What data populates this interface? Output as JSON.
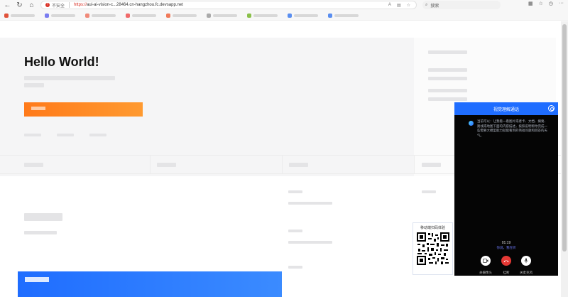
{
  "browser": {
    "insecure_label": "不安全",
    "url_proto": "https://",
    "url_rest": "aui-ai-vision-c...",
    "url_tail": "28464.cn-hangzhou.fc.devsapp.net",
    "search_placeholder": "搜索",
    "back_icon": "←",
    "refresh_icon": "↻",
    "home_icon": "⌂",
    "star_icon": "☆",
    "ellipsis": "···"
  },
  "colors": {
    "accent_blue": "#1f6dff",
    "cta_orange": "#ff7a1a",
    "hangup_red": "#e53935"
  },
  "hero": {
    "title": "Hello World!"
  },
  "qr": {
    "title": "移动端扫码体验"
  },
  "call_panel": {
    "title": "视觉理解通话",
    "message": "当前可以：让我看一看图片或者卡、文档、摘要、路线或地图下面的内容描述，按照说明帮你完成一些需要大模型能力就能看到的简短问题和回答的天气。",
    "timer": "01:19",
    "status": "你说，我在听",
    "controls": [
      {
        "label": "关摄像头",
        "icon": "camera-icon"
      },
      {
        "label": "挂断",
        "icon": "hangup-icon"
      },
      {
        "label": "关麦克风",
        "icon": "mic-icon"
      }
    ]
  }
}
